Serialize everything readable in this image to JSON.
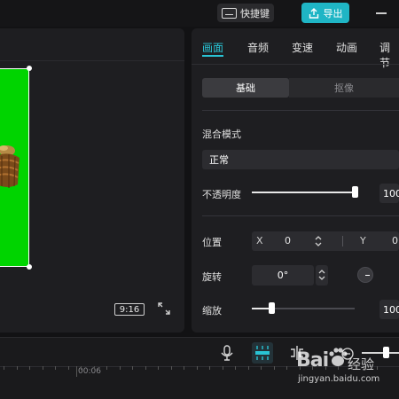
{
  "topbar": {
    "shortcut_label": "快捷键",
    "export_label": "导出"
  },
  "player": {
    "aspect_ratio": "9:16",
    "canvas_color": "#00d400"
  },
  "props": {
    "tabs": [
      {
        "label": "画面",
        "active": true
      },
      {
        "label": "音频",
        "active": false
      },
      {
        "label": "变速",
        "active": false
      },
      {
        "label": "动画",
        "active": false
      },
      {
        "label": "调节",
        "active": false
      }
    ],
    "segments": {
      "basic": "基础",
      "cutout": "抠像"
    },
    "blend_mode": {
      "label": "混合模式",
      "value": "正常"
    },
    "opacity": {
      "label": "不透明度",
      "value": "100",
      "level": 1.0
    },
    "position": {
      "label": "位置",
      "x_label": "X",
      "x_value": "0",
      "y_label": "Y",
      "y_value": "0"
    },
    "rotation": {
      "label": "旋转",
      "value": "0°"
    },
    "scale": {
      "label": "缩放",
      "value": "100",
      "level": 0.2
    }
  },
  "timeline": {
    "timecode": "00:06"
  },
  "watermark": {
    "brand": "Bai",
    "product": "经验",
    "url": "jingyan.baidu.com"
  },
  "colors": {
    "accent": "#29c3d4",
    "export_bg": "#1fb5c5"
  }
}
